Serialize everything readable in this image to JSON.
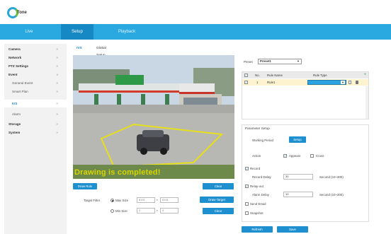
{
  "brand": {
    "logo_text": "Tone",
    "accent": "#2aa9e0",
    "button_color": "#1e8fcf"
  },
  "nav": {
    "tabs": [
      "Live",
      "Setup",
      "Playback"
    ],
    "active": "Setup"
  },
  "sidebar": {
    "items": [
      {
        "label": "Camera",
        "arrow": ">"
      },
      {
        "label": "Network",
        "arrow": ">"
      },
      {
        "label": "PTZ Settings",
        "arrow": ">"
      },
      {
        "label": "Event",
        "arrow": "v"
      },
      {
        "label": "General Event",
        "arrow": ">"
      },
      {
        "label": "Smart Plan",
        "arrow": ">"
      },
      {
        "label": "IVS",
        "arrow": ">"
      },
      {
        "label": "Alarm",
        "arrow": ">"
      },
      {
        "label": "Storage",
        "arrow": ">"
      },
      {
        "label": "System",
        "arrow": ">"
      }
    ]
  },
  "content_tabs": [
    "IVS",
    "Global Setup"
  ],
  "video": {
    "overlay_text": "Drawing is completed!"
  },
  "buttons": {
    "draw_rule": "Draw Rule",
    "clear1": "Clear",
    "draw_target": "Draw Target",
    "clear2": "Clear",
    "refresh": "Refresh",
    "save": "Save",
    "period_setup": "Setup"
  },
  "target_filter": {
    "label": "Target Filter",
    "max_label": "Max Size",
    "max_w": "8191",
    "max_h": "8191",
    "min_label": "Min Size",
    "min_w": "0",
    "min_h": "0",
    "sep": "*"
  },
  "preset": {
    "label": "Preset",
    "value": "Preset1"
  },
  "rule_table": {
    "headers": [
      "No.",
      "Rule Name",
      "Rule Type"
    ],
    "row": {
      "no": "1",
      "name": "Rule1"
    }
  },
  "parameters": {
    "title": "Parameter Setup",
    "working_period": "Working Period",
    "action": "Action",
    "appears": "Appears",
    "cross": "Cross",
    "record": "Record",
    "record_delay": "Record Delay",
    "record_delay_value": "30",
    "record_delay_unit": "Second (10~300)",
    "relay_out": "Relay-out",
    "alarm_delay": "Alarm Delay",
    "alarm_delay_value": "10",
    "alarm_delay_unit": "Second (10~300)",
    "send_email": "Send Email",
    "snapshot": "Snapshot"
  }
}
